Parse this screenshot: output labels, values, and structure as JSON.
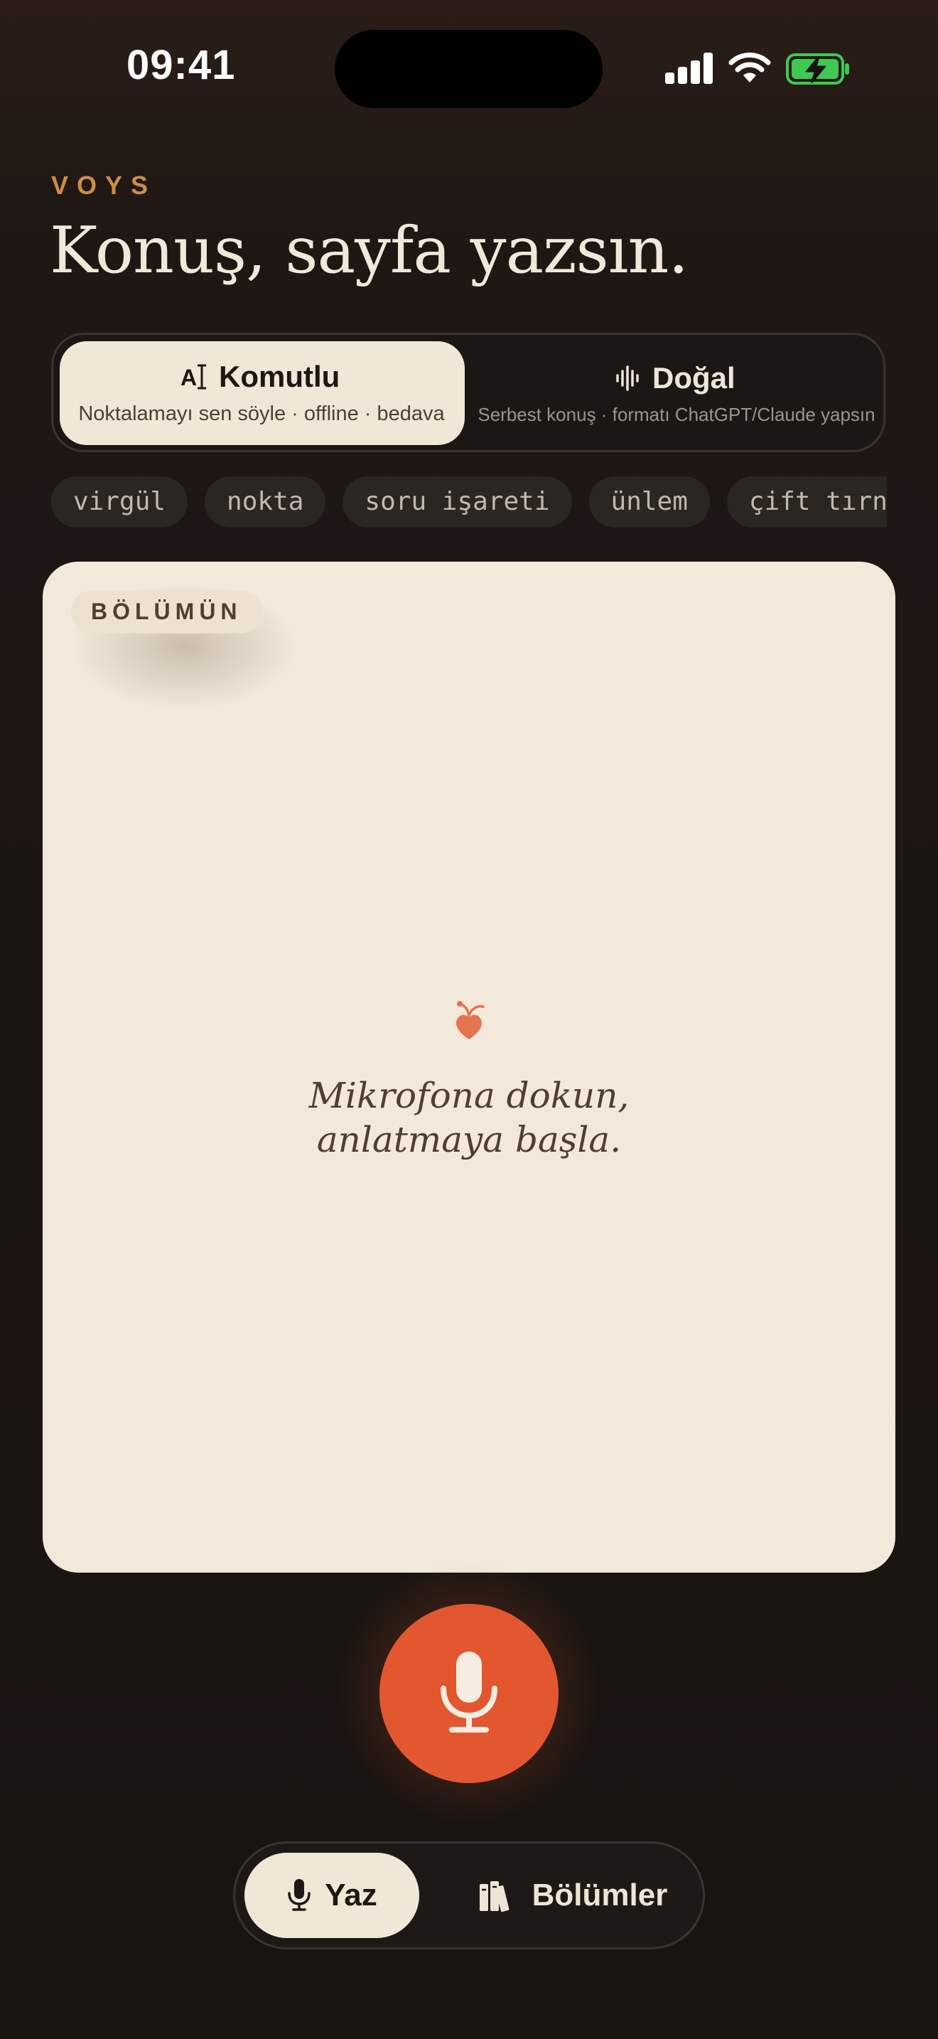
{
  "status": {
    "time": "09:41",
    "battery_color": "#3ec952"
  },
  "app": {
    "brand": "VOYS",
    "headline": "Konuş, sayfa yazsın."
  },
  "modes": [
    {
      "title": "Komutlu",
      "subtitle": "Noktalamayı sen söyle · offline · bedava",
      "icon": "text-cursor-icon",
      "selected": true
    },
    {
      "title": "Doğal",
      "subtitle": "Serbest konuş · formatı ChatGPT/Claude yapsın",
      "icon": "waveform-icon",
      "selected": false
    }
  ],
  "commands": [
    "virgül",
    "nokta",
    "soru işareti",
    "ünlem",
    "çift tırnak"
  ],
  "page": {
    "tag": "BÖLÜMÜN",
    "icon": "sprout-heart-icon",
    "empty_line1": "Mikrofona dokun,",
    "empty_line2": "anlatmaya başla."
  },
  "record": {
    "icon": "microphone-icon",
    "color": "#e25730"
  },
  "tabs": [
    {
      "label": "Yaz",
      "icon": "microphone-icon",
      "selected": true
    },
    {
      "label": "Bölümler",
      "icon": "books-icon",
      "selected": false
    }
  ]
}
